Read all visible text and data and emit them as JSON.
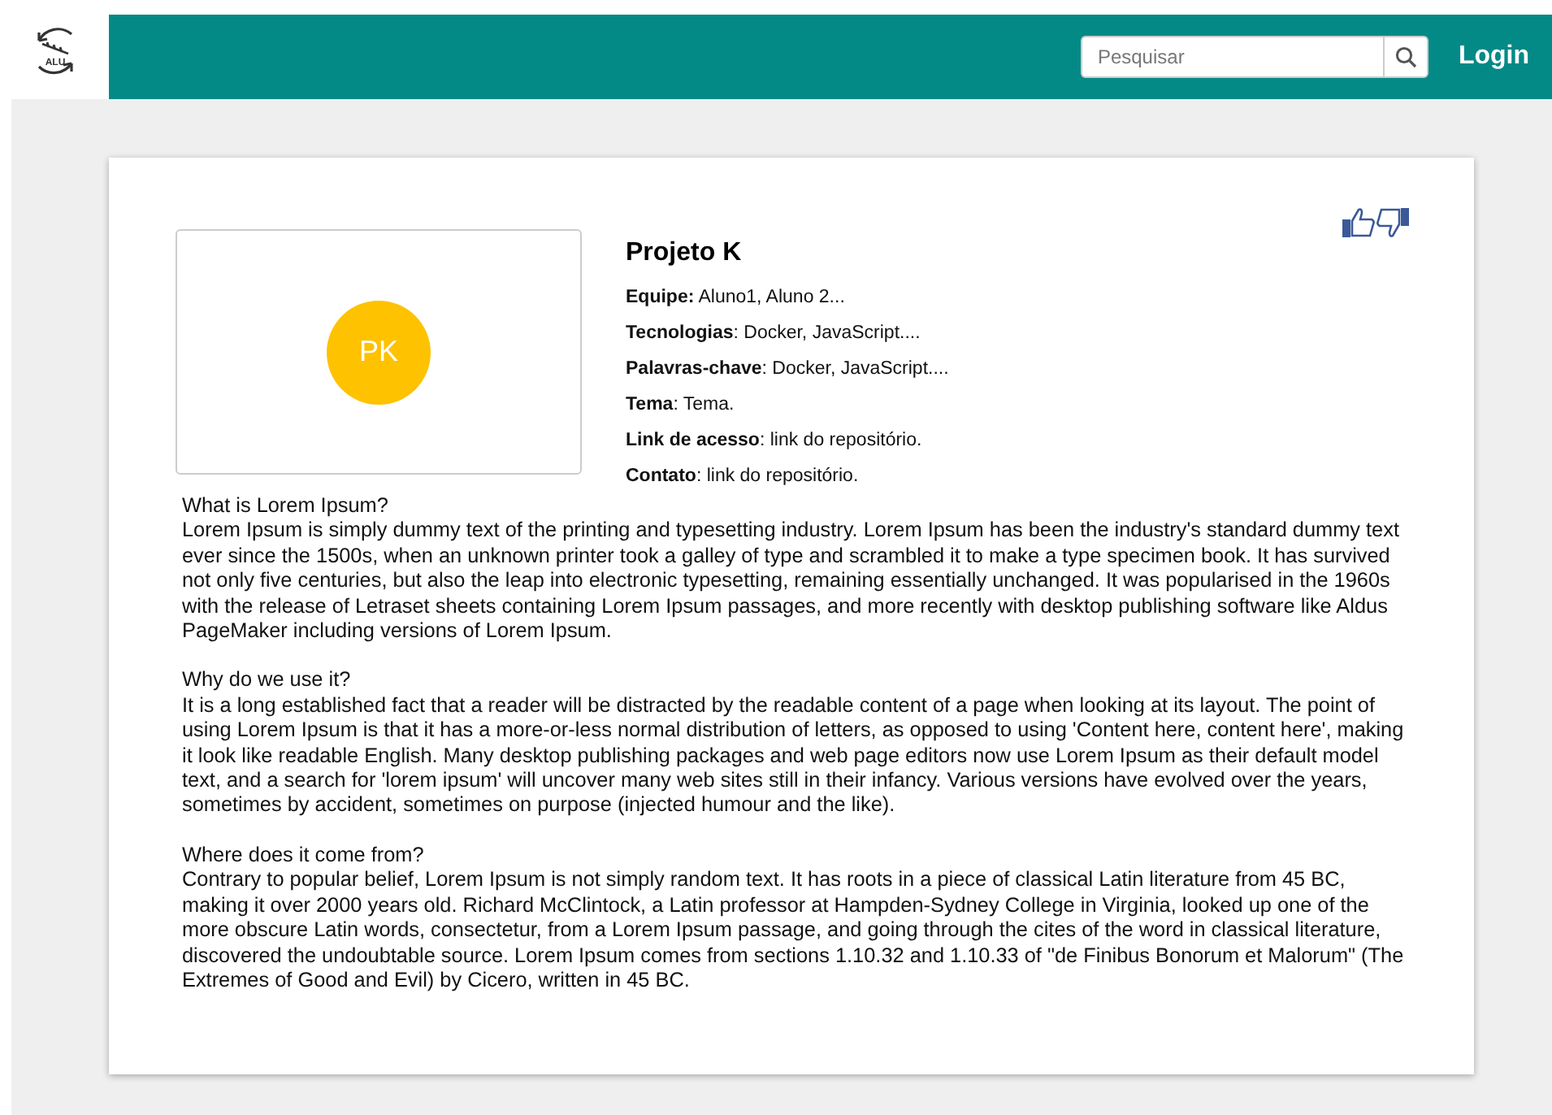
{
  "header": {
    "logo_text": "ALU",
    "search": {
      "placeholder": "Pesquisar"
    },
    "login": "Login"
  },
  "project": {
    "avatar": "PK",
    "title": "Projeto K",
    "fields": [
      "**Equipe:** Aluno1,  Aluno 2...",
      "**Tecnologias**: Docker, JavaScript....",
      "**Palavras-chave**: Docker, JavaScript....",
      "**Tema**: Tema.",
      "**Link de acesso**: link do repositório.",
      "**Contato**: link do repositório."
    ]
  },
  "sections": [
    {
      "title": "What is Lorem Ipsum?",
      "body": "Lorem Ipsum is simply dummy text of the printing and typesetting industry. Lorem Ipsum has been the industry's standard dummy text ever since the 1500s, when an unknown printer took a galley of type and scrambled it to make a type specimen book. It has survived not only five centuries, but also the leap into electronic typesetting, remaining essentially unchanged. It was popularised in the 1960s with the release of Letraset sheets containing Lorem Ipsum passages, and more recently with desktop publishing software like Aldus PageMaker including versions of Lorem Ipsum."
    },
    {
      "title": "Why do we use it?",
      "body": "It is a long established fact that a reader will be distracted by the readable content of a page when looking at its layout. The point of using Lorem Ipsum is that it has a more-or-less normal distribution of letters, as opposed to using 'Content here, content here', making it look like readable English. Many desktop publishing packages and web page editors now use Lorem Ipsum as their default model text, and a search for 'lorem ipsum' will uncover many web sites still in their infancy. Various versions have evolved over the years, sometimes by accident, sometimes on purpose (injected humour and the like)."
    },
    {
      "title": "Where does it come from?",
      "body": "Contrary to popular belief, Lorem Ipsum is not simply random text. It has roots in a piece of classical Latin literature from 45 BC, making it over 2000 years old. Richard McClintock, a Latin professor at Hampden-Sydney College in Virginia, looked up one of the more obscure Latin words, consectetur, from a Lorem Ipsum passage, and going through the cites of the word in classical literature, discovered the undoubtable source. Lorem Ipsum comes from sections 1.10.32 and 1.10.33 of \"de Finibus Bonorum et Malorum\" (The Extremes of Good and Evil) by Cicero, written in 45 BC."
    }
  ]
}
